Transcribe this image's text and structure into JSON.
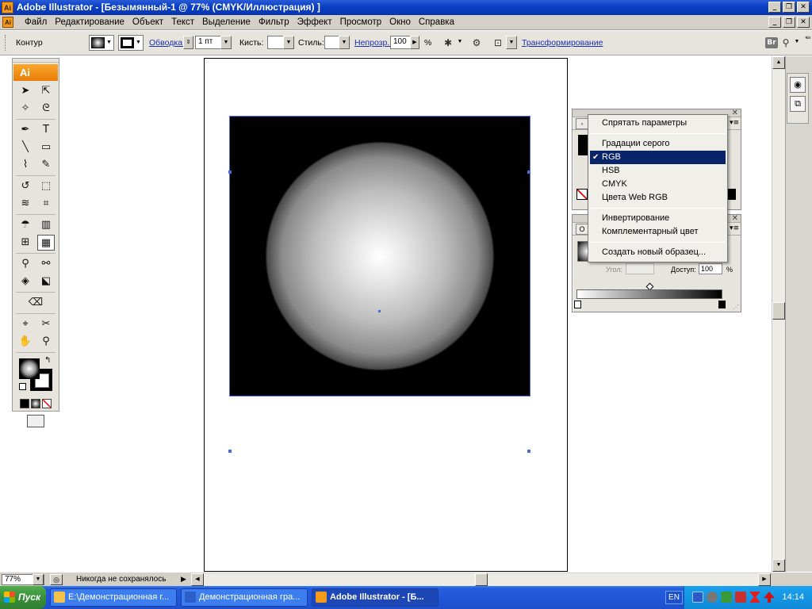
{
  "window": {
    "title": "Adobe Illustrator - [Безымянный-1 @ 77% (CMYK/Иллюстрация) ]",
    "app_icon_text": "Ai",
    "buttons": [
      "_",
      "❐",
      "✕"
    ]
  },
  "menubar": {
    "doc_icon_text": "Ai",
    "items": [
      "Файл",
      "Редактирование",
      "Объект",
      "Текст",
      "Выделение",
      "Фильтр",
      "Эффект",
      "Просмотр",
      "Окно",
      "Справка"
    ]
  },
  "controlbar": {
    "kontur": "Контур",
    "obvodka": "Обводка:",
    "stroke_weight": "1 пт",
    "kist": "Кисть:",
    "stil": "Стиль:",
    "neprozr": "Непрозр.:",
    "opacity": "100",
    "percent": "%",
    "transform": "Трансформирование",
    "bridge": "Br"
  },
  "tools": {
    "logo": "Ai",
    "rows": [
      [
        "selection-icon",
        "direct-selection-icon"
      ],
      [
        "magic-wand-icon",
        "lasso-icon"
      ],
      [
        "pen-icon",
        "type-icon"
      ],
      [
        "line-icon",
        "rectangle-icon"
      ],
      [
        "paintbrush-icon",
        "pencil-icon"
      ],
      [
        "rotate-icon",
        "scale-icon"
      ],
      [
        "warp-icon",
        "free-transform-icon"
      ],
      [
        "symbol-sprayer-icon",
        "graph-icon"
      ],
      [
        "mesh-icon",
        "gradient-icon"
      ],
      [
        "eyedropper-icon",
        "blend-icon"
      ],
      [
        "live-paint-icon",
        "live-paint-select-icon"
      ],
      [
        "eraser-icon"
      ],
      [
        "slice-icon",
        "scissors-icon"
      ],
      [
        "hand-icon",
        "zoom-icon"
      ]
    ],
    "glyphs": {
      "selection-icon": "➤",
      "direct-selection-icon": "⇱",
      "magic-wand-icon": "✧",
      "lasso-icon": "ᘓ",
      "pen-icon": "✒",
      "type-icon": "T",
      "line-icon": "╲",
      "rectangle-icon": "▭",
      "paintbrush-icon": "⌇",
      "pencil-icon": "✎",
      "rotate-icon": "↺",
      "scale-icon": "⬚",
      "warp-icon": "≋",
      "free-transform-icon": "⌗",
      "symbol-sprayer-icon": "☂",
      "graph-icon": "▥",
      "mesh-icon": "⊞",
      "gradient-icon": "▦",
      "eyedropper-icon": "⚲",
      "blend-icon": "⚯",
      "live-paint-icon": "◈",
      "live-paint-select-icon": "⬕",
      "eraser-icon": "⌫",
      "slice-icon": "⌖",
      "scissors-icon": "✂",
      "hand-icon": "✋",
      "zoom-icon": "⚲"
    },
    "active_tool": "gradient-icon",
    "swap": "↰"
  },
  "context_menu": {
    "items": [
      {
        "label": "Спрятать параметры",
        "checked": false,
        "selected": false
      },
      {
        "sep": true
      },
      {
        "label": "Градации серого",
        "checked": false,
        "selected": false
      },
      {
        "label": "RGB",
        "checked": true,
        "selected": true
      },
      {
        "label": "HSB",
        "checked": false,
        "selected": false
      },
      {
        "label": "CMYK",
        "checked": false,
        "selected": false
      },
      {
        "label": "Цвета Web RGB",
        "checked": false,
        "selected": false
      },
      {
        "sep": true
      },
      {
        "label": "Инвертирование",
        "checked": false,
        "selected": false
      },
      {
        "label": "Комплементарный цвет",
        "checked": false,
        "selected": false
      },
      {
        "sep": true
      },
      {
        "label": "Создать новый образец...",
        "checked": false,
        "selected": false
      }
    ]
  },
  "gradient_panel": {
    "tab_label": "О",
    "angle_label": "Угол:",
    "location_label": "Доступ:",
    "location_value": "100",
    "percent": "%"
  },
  "statusbar": {
    "zoom": "77%",
    "status": "Никогда не сохранялось"
  },
  "taskbar": {
    "start": "Пуск",
    "buttons": [
      {
        "label": "E:\\Демонстрационная г...",
        "active": false,
        "color": "#f4c24a"
      },
      {
        "label": "Демонстрационная гра...",
        "active": false,
        "color": "#2b5fc7"
      },
      {
        "label": "Adobe Illustrator - [Б...",
        "active": true,
        "color": "#f39b1b"
      }
    ],
    "lang": "EN",
    "clock": "14:14"
  }
}
